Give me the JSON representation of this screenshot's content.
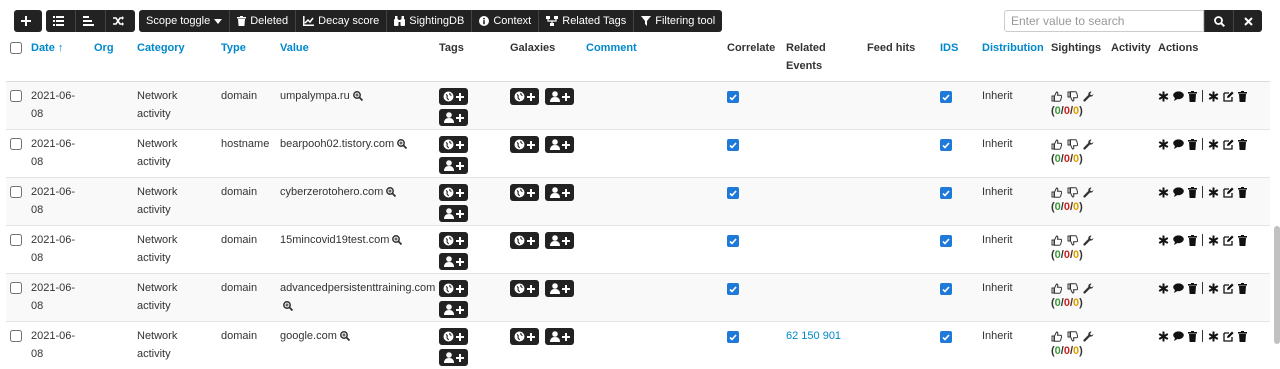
{
  "toolbar": {
    "scope_toggle": "Scope toggle",
    "deleted": "Deleted",
    "decay_score": "Decay score",
    "sightingdb": "SightingDB",
    "context": "Context",
    "related_tags": "Related Tags",
    "filtering_tool": "Filtering tool"
  },
  "search": {
    "placeholder": "Enter value to search"
  },
  "columns": {
    "date": "Date ↑",
    "org": "Org",
    "category": "Category",
    "type": "Type",
    "value": "Value",
    "tags": "Tags",
    "galaxies": "Galaxies",
    "comment": "Comment",
    "correlate": "Correlate",
    "related_events_1": "Related",
    "related_events_2": "Events",
    "feed_hits": "Feed hits",
    "ids": "IDS",
    "distribution": "Distribution",
    "sightings": "Sightings",
    "activity": "Activity",
    "actions": "Actions"
  },
  "rows": [
    {
      "date": "2021-06-08",
      "org": "",
      "category": "Network activity",
      "type": "domain",
      "value": "umpalympa.ru",
      "correlate": true,
      "related_events": "",
      "ids": true,
      "distribution": "Inherit",
      "sightings": [
        "0",
        "0",
        "0"
      ]
    },
    {
      "date": "2021-06-08",
      "org": "",
      "category": "Network activity",
      "type": "hostname",
      "value": "bearpooh02.tistory.com",
      "correlate": true,
      "related_events": "",
      "ids": true,
      "distribution": "Inherit",
      "sightings": [
        "0",
        "0",
        "0"
      ]
    },
    {
      "date": "2021-06-08",
      "org": "",
      "category": "Network activity",
      "type": "domain",
      "value": "cyberzerotohero.com",
      "correlate": true,
      "related_events": "",
      "ids": true,
      "distribution": "Inherit",
      "sightings": [
        "0",
        "0",
        "0"
      ]
    },
    {
      "date": "2021-06-08",
      "org": "",
      "category": "Network activity",
      "type": "domain",
      "value": "15mincovid19test.com",
      "correlate": true,
      "related_events": "",
      "ids": true,
      "distribution": "Inherit",
      "sightings": [
        "0",
        "0",
        "0"
      ]
    },
    {
      "date": "2021-06-08",
      "org": "",
      "category": "Network activity",
      "type": "domain",
      "value": "advancedpersistenttraining.com",
      "correlate": true,
      "related_events": "",
      "ids": true,
      "distribution": "Inherit",
      "sightings": [
        "0",
        "0",
        "0"
      ]
    },
    {
      "date": "2021-06-08",
      "org": "",
      "category": "Network activity",
      "type": "domain",
      "value": "google.com",
      "correlate": true,
      "related_events": "62 150 901",
      "ids": true,
      "distribution": "Inherit",
      "sightings": [
        "0",
        "0",
        "0"
      ]
    }
  ],
  "icons": {
    "add": "plus-icon",
    "list": "list-icon",
    "list_align": "align-left-icon",
    "shuffle": "random-icon",
    "deleted": "trash-icon",
    "decay": "chart-icon",
    "sightingdb": "binoculars-icon",
    "context": "info-icon",
    "related_tags": "sitemap-icon",
    "filter": "filter-icon",
    "search": "search-icon",
    "clear": "times-icon"
  },
  "colors": {
    "accent": "#0088cc",
    "toolbar": "#222222",
    "check": "#1e7ad6",
    "sight_green": "#3a9a3a",
    "sight_red": "#cc2222",
    "sight_orange": "#e39b00"
  }
}
